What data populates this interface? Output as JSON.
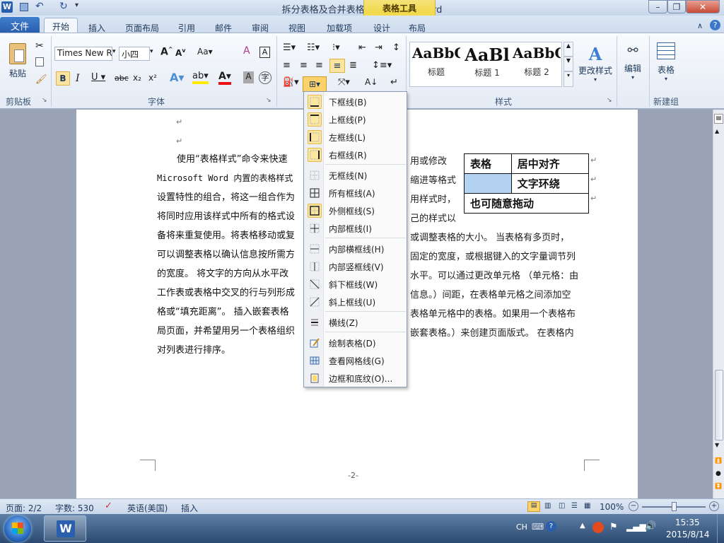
{
  "window": {
    "title": "拆分表格及合并表格 - Microsoft Word",
    "contextual_tab": "表格工具"
  },
  "tabs": [
    "文件",
    "开始",
    "插入",
    "页面布局",
    "引用",
    "邮件",
    "审阅",
    "视图",
    "加载项",
    "设计",
    "布局"
  ],
  "ribbon": {
    "clipboard": {
      "paste": "粘贴",
      "group": "剪贴板"
    },
    "font": {
      "name": "Times New R",
      "size": "小四",
      "group": "字体"
    },
    "styles": {
      "items": [
        {
          "sample": "AaBbC",
          "name": "标题"
        },
        {
          "sample": "AaBl",
          "name": "标题 1"
        },
        {
          "sample": "AaBbC",
          "name": "标题 2"
        }
      ],
      "change_styles": "更改样式",
      "group": "样式"
    },
    "editing": {
      "label": "编辑"
    },
    "table": {
      "label": "表格",
      "group": "新建组"
    }
  },
  "document": {
    "lines": [
      "使用“表格样式”命令来快速",
      "Microsoft Word 内置的表格样式",
      "设置特性的组合，将这一组合作为",
      "将同时应用该样式中所有的格式设",
      "备将来重复使用。将表格移动或复",
      "可以调整表格以确认信息按所需方",
      "的宽度。   将文字的方向从水平改",
      "工作表或表格中交叉的行与列形成",
      "格或“填充距离”。  插入嵌套表格",
      "局页面，并希望用另一个表格组织",
      "对列表进行排序。"
    ],
    "right_fragments": [
      "用或修改",
      "缩进等格式",
      "用样式时，",
      "己的样式以",
      "或调整表格的大小。  当表格有多页时，",
      "固定的宽度，或根据键入的文字量调节列",
      "水平。可以通过更改单元格  （单元格：由",
      "信息。）间距，在表格单元格之间添加空",
      "表格单元格中的表格。如果用一个表格布",
      "嵌套表格。）来创建页面版式。  在表格内"
    ],
    "table": [
      [
        "表格",
        "居中对齐"
      ],
      [
        "",
        "文字环绕"
      ],
      [
        "也可随意拖动"
      ]
    ],
    "page_number": "-2-"
  },
  "menu": {
    "items": [
      {
        "label": "下框线(B)",
        "icon": "border-bottom-icon",
        "active": true
      },
      {
        "label": "上框线(P)",
        "icon": "border-top-icon",
        "active": true
      },
      {
        "label": "左框线(L)",
        "icon": "border-left-icon",
        "active": true
      },
      {
        "label": "右框线(R)",
        "icon": "border-right-icon",
        "active": true
      },
      {
        "label": "无框线(N)",
        "icon": "border-none-icon",
        "active": false
      },
      {
        "label": "所有框线(A)",
        "icon": "border-all-icon",
        "active": false
      },
      {
        "label": "外侧框线(S)",
        "icon": "border-outside-icon",
        "active": true
      },
      {
        "label": "内部框线(I)",
        "icon": "border-inside-icon",
        "active": false
      },
      {
        "label": "内部横框线(H)",
        "icon": "border-inside-horizontal-icon",
        "active": false
      },
      {
        "label": "内部竖框线(V)",
        "icon": "border-inside-vertical-icon",
        "active": false
      },
      {
        "label": "斜下框线(W)",
        "icon": "diagonal-down-icon",
        "active": false
      },
      {
        "label": "斜上框线(U)",
        "icon": "diagonal-up-icon",
        "active": false
      },
      {
        "label": "横线(Z)",
        "icon": "horizontal-line-icon",
        "active": false
      },
      {
        "label": "绘制表格(D)",
        "icon": "draw-table-icon",
        "active": false
      },
      {
        "label": "查看网格线(G)",
        "icon": "view-gridlines-icon",
        "active": false
      },
      {
        "label": "边框和底纹(O)...",
        "icon": "borders-shading-icon",
        "active": false
      }
    ]
  },
  "status": {
    "page": "页面: 2/2",
    "words": "字数: 530",
    "language": "英语(美国)",
    "mode": "插入",
    "zoom": "100%"
  },
  "taskbar": {
    "ime": "CH",
    "time": "15:35",
    "date": "2015/8/14"
  },
  "colors": {
    "accent": "#2a5fae",
    "contextual": "#f2d84a",
    "menu_highlight": "#fbe7a1",
    "cell_selected": "#b4d2f2"
  }
}
